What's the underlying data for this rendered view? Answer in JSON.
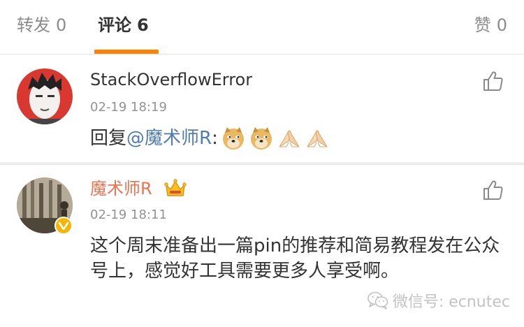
{
  "tabs": {
    "repost_label": "转发",
    "repost_count": "0",
    "comments_label": "评论",
    "comments_count": "6",
    "likes_label": "赞",
    "likes_count": "0"
  },
  "comments": [
    {
      "username": "StackOverflowError",
      "time": "02-19 18:19",
      "reply_prefix": "回复",
      "mention": "@魔术师R",
      "separator": ":",
      "emojis": [
        "doge-emoji",
        "doge-emoji",
        "praying-hands-emoji",
        "praying-hands-emoji"
      ]
    },
    {
      "username": "魔术师R",
      "time": "02-19 18:11",
      "text": "这个周末准备出一篇pin的推荐和简易教程发在公众号上，感觉好工具需要更多人享受啊。",
      "badges": [
        "crown-icon",
        "verified-badge"
      ]
    }
  ],
  "watermark": {
    "text": "微信号: ecnutec"
  },
  "colors": {
    "accent_underline": "#ff8200",
    "mention": "#507daf",
    "vip_username": "#eb7350",
    "muted": "#939393"
  }
}
